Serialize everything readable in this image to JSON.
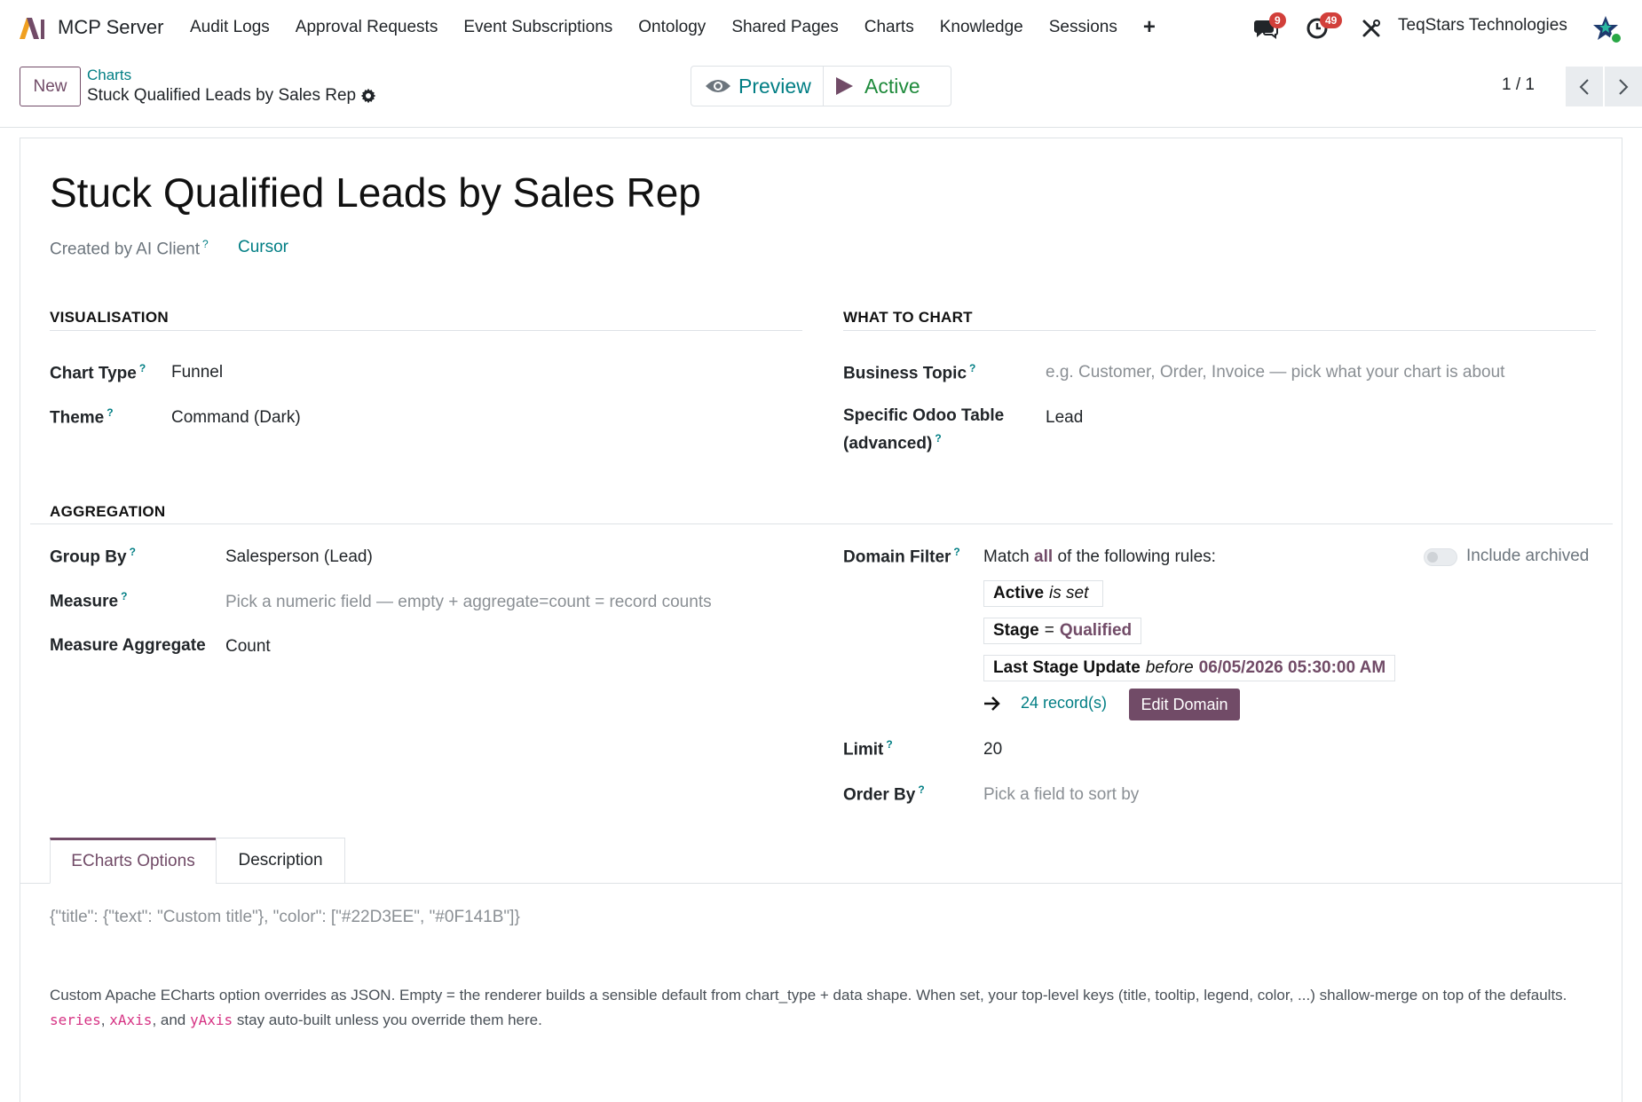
{
  "navbar": {
    "app_name": "MCP Server",
    "menu": [
      "Audit Logs",
      "Approval Requests",
      "Event Subscriptions",
      "Ontology",
      "Shared Pages",
      "Charts",
      "Knowledge",
      "Sessions"
    ],
    "plus": "+",
    "messages_badge": "9",
    "activities_badge": "49",
    "company": "TeqStars Technologies",
    "icons": [
      "chat-icon",
      "clock-icon",
      "tools-icon",
      "star-avatar-icon"
    ],
    "brand_color": "#714b67",
    "link_color": "#017e84"
  },
  "control_panel": {
    "new_label": "New",
    "breadcrumb_parent": "Charts",
    "breadcrumb_current": "Stuck Qualified Leads by Sales Rep",
    "preview_label": "Preview",
    "active_label": "Active",
    "pager": "1 / 1"
  },
  "form": {
    "title": "Stuck Qualified Leads by Sales Rep",
    "created_by_label": "Created by AI Client",
    "created_by_value": "Cursor",
    "visualisation": {
      "heading": "VISUALISATION",
      "chart_type_label": "Chart Type",
      "chart_type_value": "Funnel",
      "theme_label": "Theme",
      "theme_value": "Command (Dark)"
    },
    "what_to_chart": {
      "heading": "WHAT TO CHART",
      "business_topic_label": "Business Topic",
      "business_topic_placeholder": "e.g. Customer, Order, Invoice — pick what your chart is about",
      "table_label_1": "Specific Odoo Table",
      "table_label_2": "(advanced)",
      "table_value": "Lead"
    },
    "aggregation": {
      "heading": "AGGREGATION",
      "group_by_label": "Group By",
      "group_by_value": "Salesperson (Lead)",
      "measure_label": "Measure",
      "measure_placeholder": "Pick a numeric field — empty + aggregate=count = record counts",
      "measure_agg_label": "Measure Aggregate",
      "measure_agg_value": "Count"
    },
    "domain": {
      "label": "Domain Filter",
      "match_prefix": "Match",
      "match_all": "all",
      "match_suffix": "of the following rules:",
      "include_archived": "Include archived",
      "rules": [
        {
          "field": "Active",
          "op": "is set",
          "value": ""
        },
        {
          "field": "Stage",
          "op": "=",
          "value": "Qualified"
        },
        {
          "field": "Last Stage Update",
          "op": "before",
          "value": "06/05/2026 05:30:00 AM"
        }
      ],
      "records": "24 record(s)",
      "edit_label": "Edit Domain"
    },
    "limit_label": "Limit",
    "limit_value": "20",
    "order_by_label": "Order By",
    "order_by_placeholder": "Pick a field to sort by"
  },
  "tabs": {
    "items": [
      "ECharts Options",
      "Description"
    ],
    "active": "ECharts Options",
    "json_placeholder": "{\"title\": {\"text\": \"Custom title\"}, \"color\": [\"#22D3EE\", \"#0F141B\"]}",
    "help_1": "Custom Apache ECharts option overrides as JSON. Empty = the renderer builds a sensible default from chart_type + data shape. When set, your top-level keys (title, tooltip, legend, color, ...) shallow-merge on top of the defaults.",
    "help_code_1": "series",
    "help_sep_1": ",",
    "help_code_2": "xAxis",
    "help_sep_2": ", and",
    "help_code_3": "yAxis",
    "help_2": "stay auto-built unless you override them here."
  }
}
